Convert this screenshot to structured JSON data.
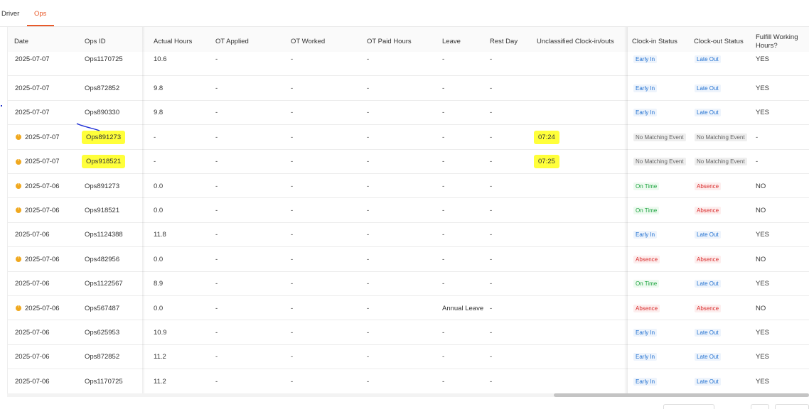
{
  "tabs": [
    {
      "label": "Driver",
      "active": false
    },
    {
      "label": "Ops",
      "active": true
    }
  ],
  "columns": {
    "date": "Date",
    "ops_id": "Ops ID",
    "actual_hours": "Actual Hours",
    "ot_applied": "OT Applied",
    "ot_worked": "OT Worked",
    "ot_paid_hours": "OT Paid Hours",
    "leave": "Leave",
    "rest_day": "Rest Day",
    "unclassified": "Unclassified Clock-in/outs",
    "clock_in_status": "Clock-in Status",
    "clock_out_status": "Clock-out Status",
    "fulfill": "Fulfill Working Hours?"
  },
  "rows": [
    {
      "warn": false,
      "date": "2025-07-07",
      "ops_id": "Ops1170725",
      "actual_hours": "10.6",
      "ot_applied": "-",
      "ot_worked": "-",
      "ot_paid_hours": "-",
      "leave": "-",
      "rest_day": "-",
      "unclassified": "",
      "clock_in": "Early In",
      "clock_in_type": "early",
      "clock_out": "Late Out",
      "clock_out_type": "late",
      "fulfill": "YES"
    },
    {
      "warn": false,
      "date": "2025-07-07",
      "ops_id": "Ops872852",
      "actual_hours": "9.8",
      "ot_applied": "-",
      "ot_worked": "-",
      "ot_paid_hours": "-",
      "leave": "-",
      "rest_day": "-",
      "unclassified": "",
      "clock_in": "Early In",
      "clock_in_type": "early",
      "clock_out": "Late Out",
      "clock_out_type": "late",
      "fulfill": "YES"
    },
    {
      "warn": false,
      "date": "2025-07-07",
      "ops_id": "Ops890330",
      "actual_hours": "9.8",
      "ot_applied": "-",
      "ot_worked": "-",
      "ot_paid_hours": "-",
      "leave": "-",
      "rest_day": "-",
      "unclassified": "",
      "clock_in": "Early In",
      "clock_in_type": "early",
      "clock_out": "Late Out",
      "clock_out_type": "late",
      "fulfill": "YES"
    },
    {
      "warn": true,
      "date": "2025-07-07",
      "ops_id": "Ops891273",
      "actual_hours": "-",
      "ot_applied": "-",
      "ot_worked": "-",
      "ot_paid_hours": "-",
      "leave": "-",
      "rest_day": "-",
      "unclassified": "07:24",
      "clock_in": "No Matching Event",
      "clock_in_type": "nomatch",
      "clock_out": "No Matching Event",
      "clock_out_type": "nomatch",
      "fulfill": "-",
      "highlight": true
    },
    {
      "warn": true,
      "date": "2025-07-07",
      "ops_id": "Ops918521",
      "actual_hours": "-",
      "ot_applied": "-",
      "ot_worked": "-",
      "ot_paid_hours": "-",
      "leave": "-",
      "rest_day": "-",
      "unclassified": "07:25",
      "clock_in": "No Matching Event",
      "clock_in_type": "nomatch",
      "clock_out": "No Matching Event",
      "clock_out_type": "nomatch",
      "fulfill": "-",
      "highlight": true
    },
    {
      "warn": true,
      "date": "2025-07-06",
      "ops_id": "Ops891273",
      "actual_hours": "0.0",
      "ot_applied": "-",
      "ot_worked": "-",
      "ot_paid_hours": "-",
      "leave": "-",
      "rest_day": "-",
      "unclassified": "",
      "clock_in": "On Time",
      "clock_in_type": "ontime",
      "clock_out": "Absence",
      "clock_out_type": "absence",
      "fulfill": "NO"
    },
    {
      "warn": true,
      "date": "2025-07-06",
      "ops_id": "Ops918521",
      "actual_hours": "0.0",
      "ot_applied": "-",
      "ot_worked": "-",
      "ot_paid_hours": "-",
      "leave": "-",
      "rest_day": "-",
      "unclassified": "",
      "clock_in": "On Time",
      "clock_in_type": "ontime",
      "clock_out": "Absence",
      "clock_out_type": "absence",
      "fulfill": "NO"
    },
    {
      "warn": false,
      "date": "2025-07-06",
      "ops_id": "Ops1124388",
      "actual_hours": "11.8",
      "ot_applied": "-",
      "ot_worked": "-",
      "ot_paid_hours": "-",
      "leave": "-",
      "rest_day": "-",
      "unclassified": "",
      "clock_in": "Early In",
      "clock_in_type": "early",
      "clock_out": "Late Out",
      "clock_out_type": "late",
      "fulfill": "YES"
    },
    {
      "warn": true,
      "date": "2025-07-06",
      "ops_id": "Ops482956",
      "actual_hours": "0.0",
      "ot_applied": "-",
      "ot_worked": "-",
      "ot_paid_hours": "-",
      "leave": "-",
      "rest_day": "-",
      "unclassified": "",
      "clock_in": "Absence",
      "clock_in_type": "absence",
      "clock_out": "Absence",
      "clock_out_type": "absence",
      "fulfill": "NO"
    },
    {
      "warn": false,
      "date": "2025-07-06",
      "ops_id": "Ops1122567",
      "actual_hours": "8.9",
      "ot_applied": "-",
      "ot_worked": "-",
      "ot_paid_hours": "-",
      "leave": "-",
      "rest_day": "-",
      "unclassified": "",
      "clock_in": "On Time",
      "clock_in_type": "ontime",
      "clock_out": "Late Out",
      "clock_out_type": "late",
      "fulfill": "YES"
    },
    {
      "warn": true,
      "date": "2025-07-06",
      "ops_id": "Ops567487",
      "actual_hours": "0.0",
      "ot_applied": "-",
      "ot_worked": "-",
      "ot_paid_hours": "-",
      "leave": "Annual Leave",
      "rest_day": "-",
      "unclassified": "",
      "clock_in": "Absence",
      "clock_in_type": "absence",
      "clock_out": "Absence",
      "clock_out_type": "absence",
      "fulfill": "NO"
    },
    {
      "warn": false,
      "date": "2025-07-06",
      "ops_id": "Ops625953",
      "actual_hours": "10.9",
      "ot_applied": "-",
      "ot_worked": "-",
      "ot_paid_hours": "-",
      "leave": "-",
      "rest_day": "-",
      "unclassified": "",
      "clock_in": "Early In",
      "clock_in_type": "early",
      "clock_out": "Late Out",
      "clock_out_type": "late",
      "fulfill": "YES"
    },
    {
      "warn": false,
      "date": "2025-07-06",
      "ops_id": "Ops872852",
      "actual_hours": "11.2",
      "ot_applied": "-",
      "ot_worked": "-",
      "ot_paid_hours": "-",
      "leave": "-",
      "rest_day": "-",
      "unclassified": "",
      "clock_in": "Early In",
      "clock_in_type": "early",
      "clock_out": "Late Out",
      "clock_out_type": "late",
      "fulfill": "YES"
    },
    {
      "warn": false,
      "date": "2025-07-06",
      "ops_id": "Ops1170725",
      "actual_hours": "11.2",
      "ot_applied": "-",
      "ot_worked": "-",
      "ot_paid_hours": "-",
      "leave": "-",
      "rest_day": "-",
      "unclassified": "",
      "clock_in": "Early In",
      "clock_in_type": "early",
      "clock_out": "Late Out",
      "clock_out_type": "late",
      "fulfill": "YES"
    }
  ],
  "colors": {
    "accent": "#e85a2a",
    "highlight": "#ffff3a",
    "warning": "#f0a81e",
    "status_blue": "#1f6fd0",
    "status_green": "#1aa33c",
    "status_red": "#d92b2b"
  }
}
